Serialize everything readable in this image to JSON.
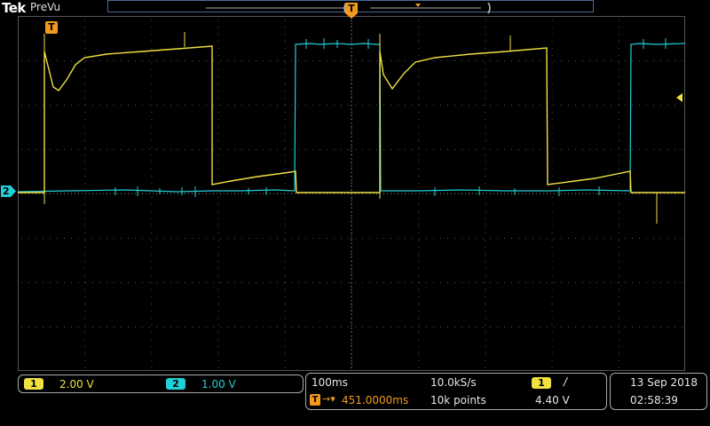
{
  "header": {
    "brand": "Tek",
    "mode": "PreVu"
  },
  "markers": {
    "trigger_label": "T",
    "ch2_label": "2"
  },
  "channels": [
    {
      "num": "1",
      "scale": "2.00 V",
      "color": "#f0e040"
    },
    {
      "num": "2",
      "scale": "1.00 V",
      "color": "#20d0d8"
    }
  ],
  "acquisition": {
    "timebase": "100ms",
    "sample_rate": "10.0kS/s",
    "trigger_delay": "451.0000ms",
    "record_length": "10k points",
    "trigger_source": "1",
    "trigger_slope": "/",
    "trigger_level": "4.40 V"
  },
  "datetime": {
    "date": "13 Sep  2018",
    "time": "02:58:39"
  },
  "colors": {
    "ch1": "#f0e040",
    "ch2": "#20d0d8",
    "trigger": "#f39a1c",
    "grid": "#3a3a3a"
  }
}
